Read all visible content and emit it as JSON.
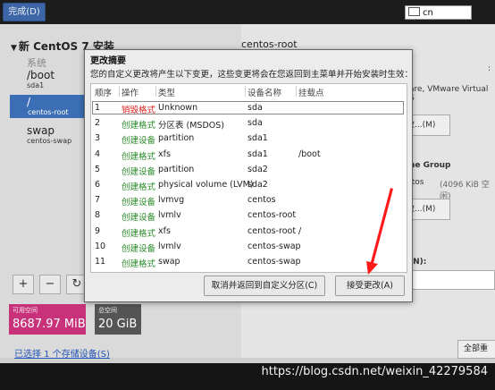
{
  "topbar": {
    "done_label": "完成(D)",
    "keyboard": "cn"
  },
  "left": {
    "tree_title": "新 CentOS 7 安装",
    "system_label": "系统",
    "mounts": [
      {
        "name": "/boot",
        "device": "sda1"
      },
      {
        "name": "/",
        "device": "centos-root"
      },
      {
        "name": "swap",
        "device": "centos-swap"
      }
    ],
    "buttons": {
      "add": "+",
      "remove": "−",
      "refresh": "↻"
    },
    "available_label": "可用空间",
    "available_value": "8687.97 MiB",
    "total_label": "总空间",
    "total_value": "20 GiB",
    "selected_link": "已选择 1 个存储设备(S)"
  },
  "right": {
    "title": "centos-root",
    "colon": ":",
    "device_text": "are, VMware Virtual S",
    "modify1": "改...(M)",
    "vg_label": "me Group",
    "vg_value": "ntos",
    "vg_free": "(4096 KiB 空闲)",
    "modify2": "改...(M)",
    "name_label": "(N):",
    "name_value": "t",
    "reset_label": "全部重"
  },
  "dialog": {
    "title": "更改摘要",
    "description": "您的自定义更改将产生以下变更，这些变更将会在您返回到主菜单并开始安装时生效：",
    "columns": [
      "顺序",
      "操作",
      "类型",
      "设备名称",
      "挂载点"
    ],
    "rows": [
      {
        "order": "1",
        "action": "销毁格式",
        "type": "Unknown",
        "device": "sda",
        "mount": ""
      },
      {
        "order": "2",
        "action": "创建格式",
        "type": "分区表 (MSDOS)",
        "device": "sda",
        "mount": ""
      },
      {
        "order": "3",
        "action": "创建设备",
        "type": "partition",
        "device": "sda1",
        "mount": ""
      },
      {
        "order": "4",
        "action": "创建格式",
        "type": "xfs",
        "device": "sda1",
        "mount": "/boot"
      },
      {
        "order": "5",
        "action": "创建设备",
        "type": "partition",
        "device": "sda2",
        "mount": ""
      },
      {
        "order": "6",
        "action": "创建格式",
        "type": "physical volume (LVM)",
        "device": "sda2",
        "mount": ""
      },
      {
        "order": "7",
        "action": "创建设备",
        "type": "lvmvg",
        "device": "centos",
        "mount": ""
      },
      {
        "order": "8",
        "action": "创建设备",
        "type": "lvmlv",
        "device": "centos-root",
        "mount": ""
      },
      {
        "order": "9",
        "action": "创建格式",
        "type": "xfs",
        "device": "centos-root",
        "mount": "/"
      },
      {
        "order": "10",
        "action": "创建设备",
        "type": "lvmlv",
        "device": "centos-swap",
        "mount": ""
      },
      {
        "order": "11",
        "action": "创建格式",
        "type": "swap",
        "device": "centos-swap",
        "mount": ""
      }
    ],
    "cancel_label": "取消并返回到自定义分区(C)",
    "accept_label": "接受更改(A)"
  },
  "watermark": "https://blog.csdn.net/weixin_42279584",
  "colors": {
    "destroy": "#dd2222",
    "create": "#2a8a2a",
    "selection": "#3b6eb5",
    "arrow": "#ff1a1a"
  }
}
